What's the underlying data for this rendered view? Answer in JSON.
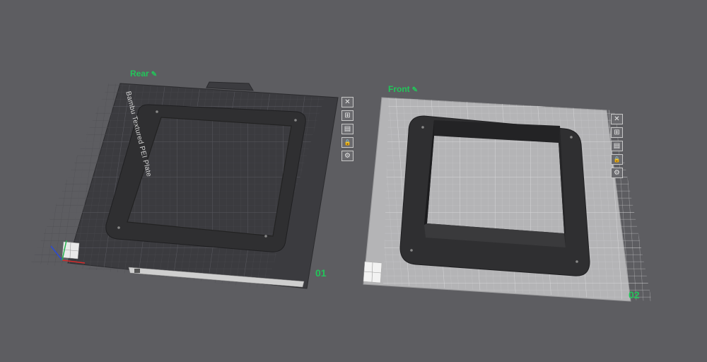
{
  "plates": [
    {
      "id": "plate-1",
      "label": "Rear",
      "number": "01",
      "plate_name_text": "Bambu Textured PEI Plate",
      "theme": "dark"
    },
    {
      "id": "plate-2",
      "label": "Front",
      "number": "02",
      "theme": "light"
    }
  ],
  "plate_tools": [
    {
      "name": "close-icon",
      "glyph": "✕"
    },
    {
      "name": "arrange-icon",
      "glyph": "⊞"
    },
    {
      "name": "orient-icon",
      "glyph": "▤"
    },
    {
      "name": "lock-icon",
      "glyph": "🔒"
    },
    {
      "name": "settings-icon",
      "glyph": "⚙"
    }
  ],
  "label_edit_glyph": "✎",
  "colors": {
    "background": "#5d5d61",
    "label_green": "#23c45a",
    "dark_plate": "#3b3b3f",
    "light_plate": "#b4b4b6",
    "part": "#2f2f31"
  }
}
